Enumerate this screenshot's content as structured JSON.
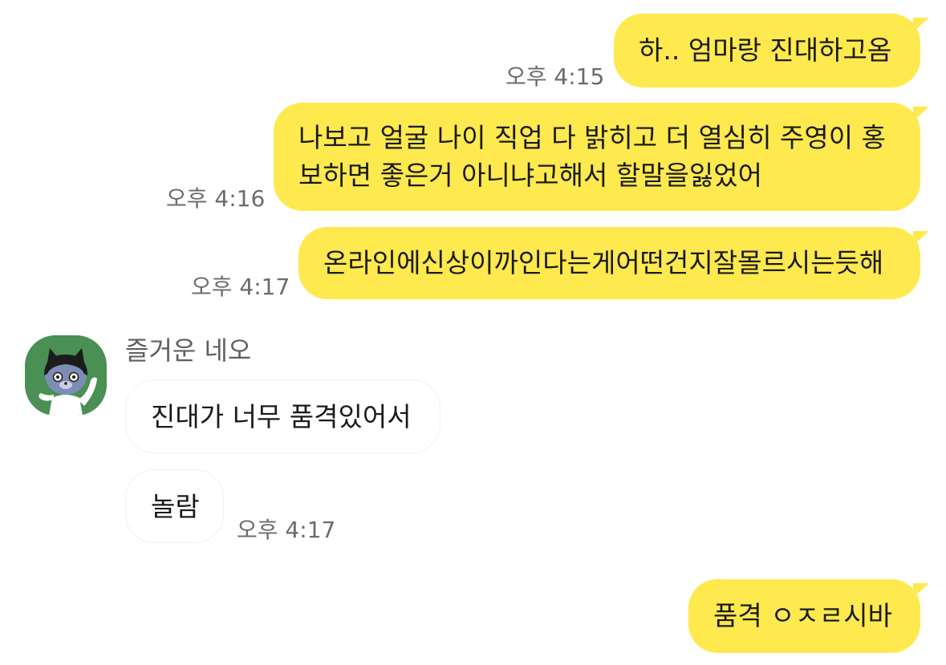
{
  "chat": {
    "messages": [
      {
        "side": "me",
        "text": "하.. 엄마랑 진대하고옴",
        "time": "오후 4:15"
      },
      {
        "side": "me",
        "lines": [
          "나보고 얼굴 나이 직업 다 밝히고 더 열심히 주영이 홍",
          "보하면 좋은거 아니냐고해서 할말을잃었어"
        ],
        "time": "오후 4:16"
      },
      {
        "side": "me",
        "text": "온라인에신상이까인다는게어떤건지잘몰르시는듯해",
        "time": "오후 4:17"
      },
      {
        "side": "them",
        "sender": "즐거운 네오",
        "text": "진대가 너무 품격있어서"
      },
      {
        "side": "them",
        "text": "놀람",
        "time": "오후 4:17"
      },
      {
        "side": "me",
        "text": "품격 ㅇㅈㄹ시바"
      }
    ]
  },
  "colors": {
    "my_bubble": "#fee94e",
    "their_bubble": "#ffffff",
    "timestamp": "#6b6b6b",
    "avatar_bg": "#4a8f53"
  },
  "icons": {
    "avatar": "neo-character-avatar"
  }
}
